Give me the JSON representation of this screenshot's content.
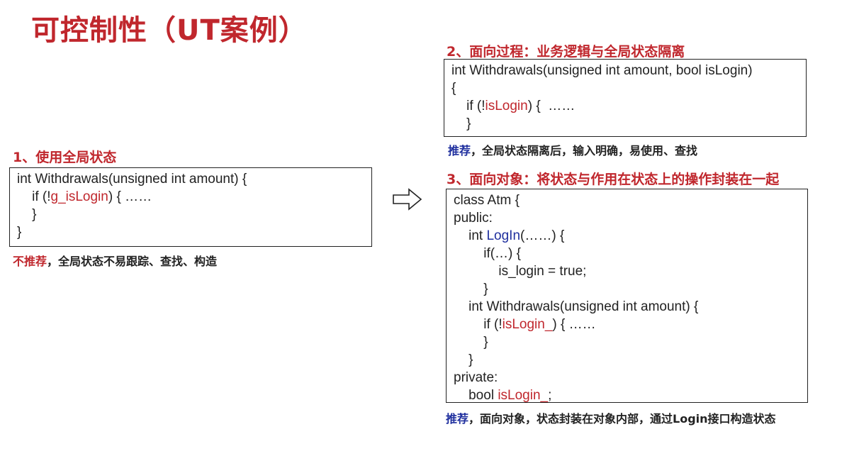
{
  "title": "可控制性（UT案例）",
  "section1": {
    "heading": "1、使用全局状态",
    "code": {
      "l1": "int Withdrawals(unsigned int amount) {",
      "l2_pre": "    if (!",
      "l2_var": "g_isLogin",
      "l2_post": ") { ……",
      "l3": "    }",
      "l4": "}"
    },
    "note_keyword": "不推荐",
    "note_text": "，全局状态不易跟踪、查找、构造"
  },
  "section2": {
    "heading": "2、面向过程：业务逻辑与全局状态隔离",
    "code": {
      "l1": "int Withdrawals(unsigned int amount, bool isLogin)",
      "l2": "{",
      "l3_pre": "    if (!",
      "l3_var": "isLogin",
      "l3_post": ") {  ……",
      "l4": "    }"
    },
    "note_keyword": "推荐",
    "note_text": "，全局状态隔离后，输入明确，易使用、查找"
  },
  "section3": {
    "heading": "3、面向对象：将状态与作用在状态上的操作封装在一起",
    "code": {
      "l1": "class Atm {",
      "l2": "public:",
      "l3_pre": "    int ",
      "l3_fn": "LogIn",
      "l3_post": "(……) {",
      "l4": "        if(…) {",
      "l5": "            is_login = true;",
      "l6": "        }",
      "l7": "    int Withdrawals(unsigned int amount) {",
      "l8_pre": "        if (!",
      "l8_var": "isLogin_",
      "l8_post": ") { ……",
      "l9": "        }",
      "l10": "    }",
      "l11": "private:",
      "l12_pre": "    bool ",
      "l12_var": "isLogin_",
      "l12_post": ";"
    },
    "note_keyword": "推荐",
    "note_text": "，面向对象，状态封装在对象内部，通过Login接口构造状态"
  },
  "colors": {
    "accent_red": "#c0272d",
    "accent_blue": "#1f2f9e"
  }
}
